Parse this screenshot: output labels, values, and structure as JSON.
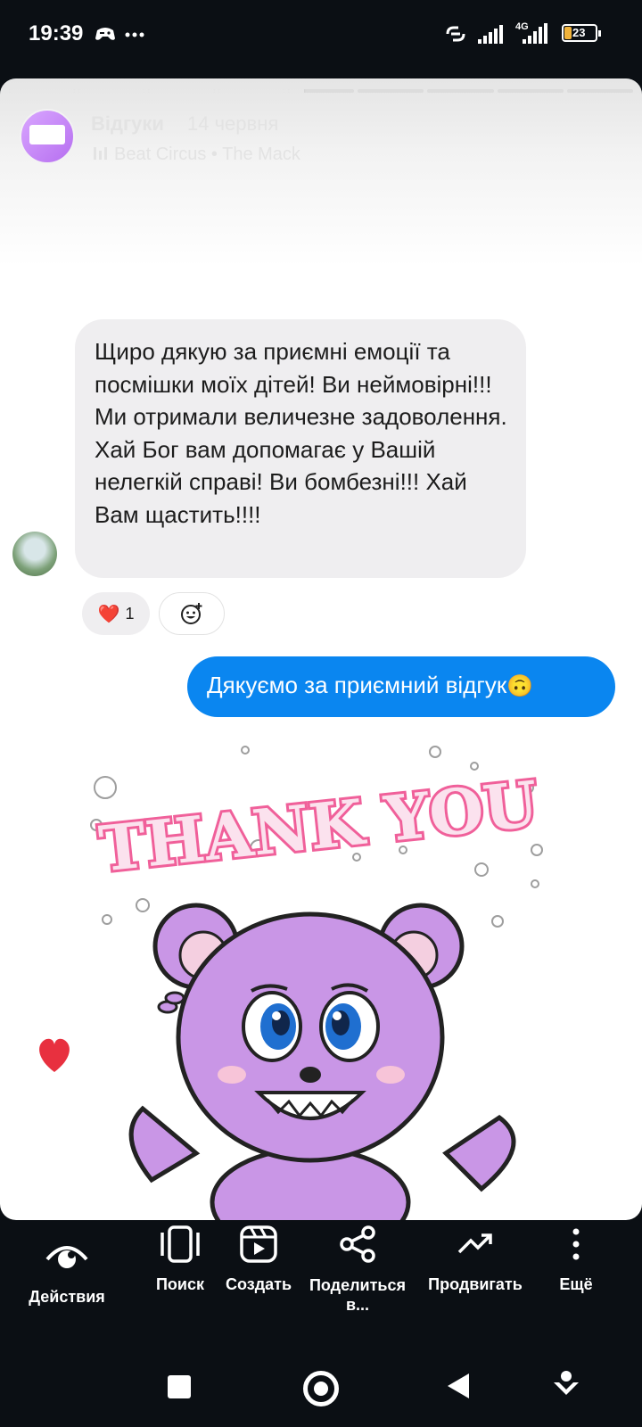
{
  "status_bar": {
    "time": "19:39",
    "network_type": "4G",
    "battery_level": "23"
  },
  "story": {
    "progress_segments": 9,
    "progress_current_index": 4,
    "progress_current_fraction": 0.25,
    "account_name": "Відгуки",
    "date": "14 червня",
    "music": "Beat Circus • The Mack"
  },
  "message_in": {
    "text": "Щиро дякую за приємні емоції та посмішки моїх дітей! Ви неймовірні!!! Ми отримали величезне задоволення. Хай Бог вам допомагає у Вашій нелегкій справі! Ви бомбезні!!! Хай Вам щастить!!!!"
  },
  "reaction": {
    "emoji": "❤️",
    "count": "1"
  },
  "message_out": {
    "text": "Дякуємо за приємний відгук",
    "emoji": "🙃"
  },
  "sticker": {
    "text": "THANK YOU"
  },
  "actions": [
    {
      "label": "Действия",
      "icon": "eye-icon"
    },
    {
      "label": "Поиск",
      "icon": "reels-search-icon"
    },
    {
      "label": "Создать",
      "icon": "create-reel-icon"
    },
    {
      "label": "Поделиться в...",
      "icon": "share-icon"
    },
    {
      "label": "Продвигать",
      "icon": "promote-trend-icon"
    },
    {
      "label": "Ещё",
      "icon": "more-vertical-icon"
    }
  ],
  "colors": {
    "outgoing_bubble": "#0a86f0",
    "incoming_bubble": "#efeef0",
    "like_heart": "#e8303f",
    "bear": "#c996e6"
  }
}
